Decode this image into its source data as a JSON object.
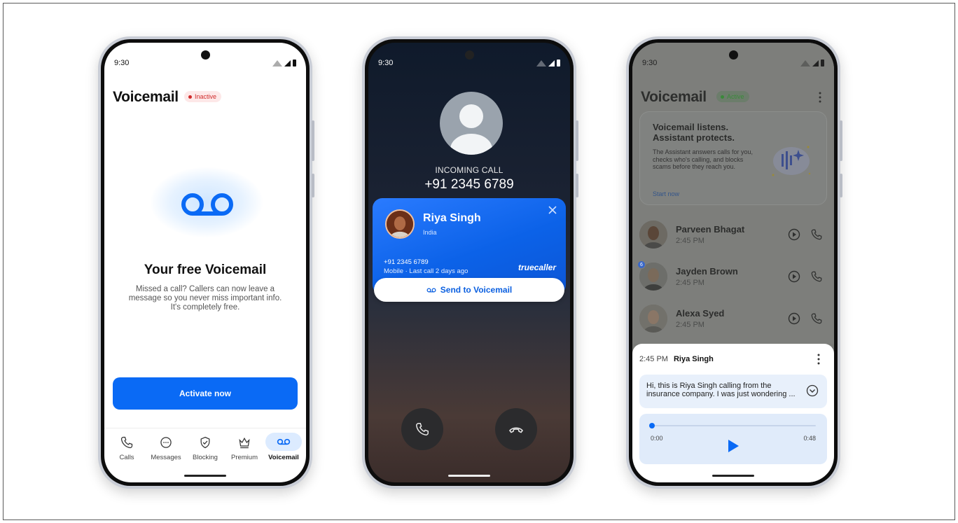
{
  "status": {
    "time": "9:30"
  },
  "phone1": {
    "title": "Voicemail",
    "badge": "Inactive",
    "heading": "Your free Voicemail",
    "description": "Missed a call? Callers can now leave a message so you never miss important info. It's completely free.",
    "cta": "Activate now",
    "tabs": [
      {
        "label": "Calls",
        "icon": "phone-icon"
      },
      {
        "label": "Messages",
        "icon": "chat-icon"
      },
      {
        "label": "Blocking",
        "icon": "shield-icon"
      },
      {
        "label": "Premium",
        "icon": "crown-icon"
      },
      {
        "label": "Voicemail",
        "icon": "voicemail-icon",
        "active": true
      }
    ]
  },
  "phone2": {
    "incoming_label": "INCOMING CALL",
    "number": "+91 2345 6789",
    "caller": {
      "name": "Riya Singh",
      "country": "India",
      "number": "+91 2345 6789",
      "meta": "Mobile · Last call 2 days ago",
      "brand": "truecaller"
    },
    "send_button": "Send to Voicemail"
  },
  "phone3": {
    "title": "Voicemail",
    "badge": "Active",
    "promo": {
      "heading_line1": "Voicemail listens.",
      "heading_line2": "Assistant protects.",
      "body": "The Assistant answers calls for you, checks who's calling, and blocks scams before they reach you.",
      "link": "Start now"
    },
    "contacts": [
      {
        "name": "Parveen Bhagat",
        "time": "2:45 PM"
      },
      {
        "name": "Jayden Brown",
        "time": "2:45 PM",
        "badge": "6"
      },
      {
        "name": "Alexa Syed",
        "time": "2:45 PM"
      }
    ],
    "sheet": {
      "time": "2:45 PM",
      "name": "Riya Singh",
      "transcript": "Hi, this is Riya Singh calling from the insurance company. I was just wondering ...",
      "elapsed": "0:00",
      "duration": "0:48",
      "progress": 0.0
    }
  },
  "colors": {
    "accent": "#0a6af5",
    "inactive": "#d02b2b",
    "active": "#3a8a3a"
  }
}
